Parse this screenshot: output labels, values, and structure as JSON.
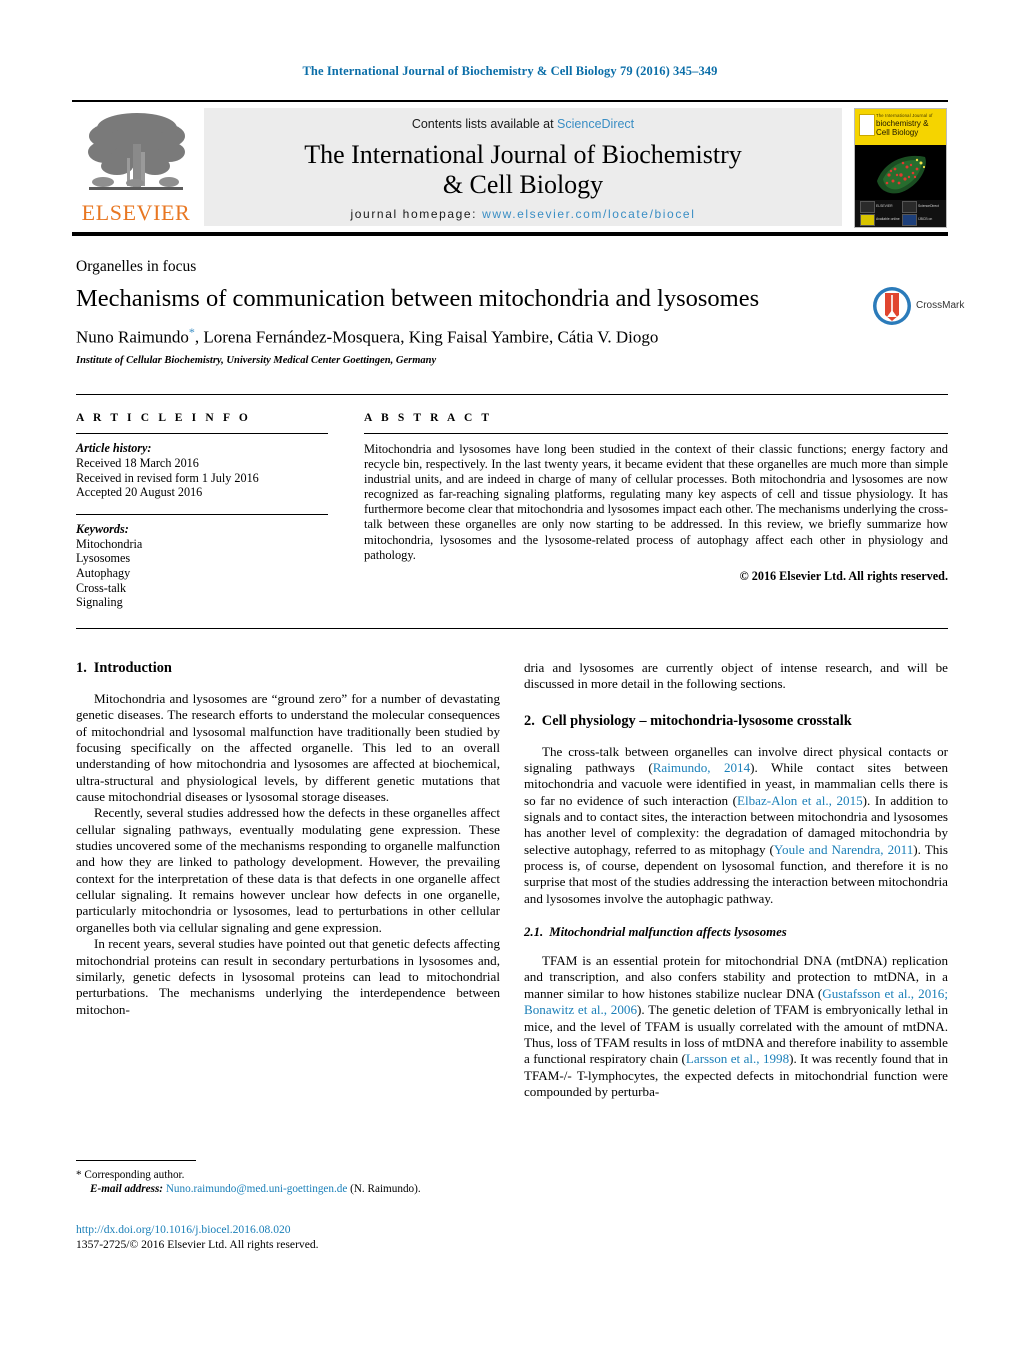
{
  "running_head": "The International Journal of Biochemistry & Cell Biology 79 (2016) 345–349",
  "masthead": {
    "publisher_name": "ELSEVIER",
    "contents_prefix": "Contents lists available at",
    "sciencedirect": "ScienceDirect",
    "journal_title_line1": "The International Journal of Biochemistry",
    "journal_title_line2": "& Cell Biology",
    "homepage_prefix": "journal homepage:",
    "homepage_url": "www.elsevier.com/locate/biocel",
    "cover": {
      "top_small": "The International Journal of",
      "title_line1": "biochemistry &",
      "title_line2": "Cell Biology",
      "icon_labels": [
        "ELSEVIER",
        "ScienceDirect",
        "Available online",
        "IJBCB on"
      ]
    },
    "accent_blue": "#3a8ec4",
    "elsevier_orange": "#E87722",
    "band_yellow": "#f5d400"
  },
  "article": {
    "section_type": "Organelles in focus",
    "title": "Mechanisms of communication between mitochondria and lysosomes",
    "authors": "Nuno Raimundo",
    "authors_rest": ", Lorena Fernández-Mosquera, King Faisal Yambire, Cátia V. Diogo",
    "corresponding_marker": "*",
    "affiliation": "Institute of Cellular Biochemistry, University Medical Center Goettingen, Germany",
    "crossmark_label": "CrossMark"
  },
  "article_info": {
    "heading": "A R T I C L E   I N F O",
    "history_label": "Article history:",
    "history": [
      "Received 18 March 2016",
      "Received in revised form 1 July 2016",
      "Accepted 20 August 2016"
    ],
    "keywords_label": "Keywords:",
    "keywords": [
      "Mitochondria",
      "Lysosomes",
      "Autophagy",
      "Cross-talk",
      "Signaling"
    ]
  },
  "abstract": {
    "heading": "A B S T R A C T",
    "text": "Mitochondria and lysosomes have long been studied in the context of their classic functions; energy factory and recycle bin, respectively. In the last twenty years, it became evident that these organelles are much more than simple industrial units, and are indeed in charge of many of cellular processes. Both mitochondria and lysosomes are now recognized as far-reaching signaling platforms, regulating many key aspects of cell and tissue physiology. It has furthermore become clear that mitochondria and lysosomes impact each other. The mechanisms underlying the cross-talk between these organelles are only now starting to be addressed. In this review, we briefly summarize how mitochondria, lysosomes and the lysosome-related process of autophagy affect each other in physiology and pathology.",
    "copyright": "© 2016 Elsevier Ltd. All rights reserved."
  },
  "body": {
    "intro_heading_num": "1.",
    "intro_heading_text": "Introduction",
    "p1": "Mitochondria and lysosomes are “ground zero” for a number of devastating genetic diseases. The research efforts to understand the molecular consequences of mitochondrial and lysosomal malfunction have traditionally been studied by focusing specifically on the affected organelle. This led to an overall understanding of how mitochondria and lysosomes are affected at biochemical, ultra-structural and physiological levels, by different genetic mutations that cause mitochondrial diseases or lysosomal storage diseases.",
    "p2": "Recently, several studies addressed how the defects in these organelles affect cellular signaling pathways, eventually modulating gene expression. These studies uncovered some of the mechanisms responding to organelle malfunction and how they are linked to pathology development. However, the prevailing context for the interpretation of these data is that defects in one organelle affect cellular signaling. It remains however unclear how defects in one organelle, particularly mitochondria or lysosomes, lead to perturbations in other cellular organelles both via cellular signaling and gene expression.",
    "p3": "In recent years, several studies have pointed out that genetic defects affecting mitochondrial proteins can result in secondary perturbations in lysosomes and, similarly, genetic defects in lysosomal proteins can lead to mitochondrial perturbations. The mechanisms underlying the interdependence between mitochon-",
    "p3_cont": "dria and lysosomes are currently object of intense research, and will be discussed in more detail in the following sections.",
    "sec2_heading_num": "2.",
    "sec2_heading_text": "Cell physiology – mitochondria-lysosome crosstalk",
    "p4_a": "The cross-talk between organelles can involve direct physical contacts or signaling pathways (",
    "p4_cite1": "Raimundo, 2014",
    "p4_b": "). While contact sites between mitochondria and vacuole were identified in yeast, in mammalian cells there is so far no evidence of such interaction (",
    "p4_cite2": "Elbaz-Alon et al., 2015",
    "p4_c": "). In addition to signals and to contact sites, the interaction between mitochondria and lysosomes has another level of complexity: the degradation of damaged mitochondria by selective autophagy, referred to as mitophagy (",
    "p4_cite3": "Youle and Narendra, 2011",
    "p4_d": "). This process is, of course, dependent on lysosomal function, and therefore it is no surprise that most of the studies addressing the interaction between mitochondria and lysosomes involve the autophagic pathway.",
    "sec21_heading_num": "2.1.",
    "sec21_heading_text": "Mitochondrial malfunction affects lysosomes",
    "p5_a": "TFAM is an essential protein for mitochondrial DNA (mtDNA) replication and transcription, and also confers stability and protection to mtDNA, in a manner similar to how histones stabilize nuclear DNA (",
    "p5_cite1": "Gustafsson et al., 2016; Bonawitz et al., 2006",
    "p5_b": "). The genetic deletion of TFAM is embryonically lethal in mice, and the level of TFAM is usually correlated with the amount of mtDNA. Thus, loss of TFAM results in loss of mtDNA and therefore inability to assemble a functional respiratory chain (",
    "p5_cite2": "Larsson et al., 1998",
    "p5_c": "). It was recently found that in TFAM-/- T-lymphocytes, the expected defects in mitochondrial function were compounded by perturba-"
  },
  "footer": {
    "corresponding_marker": "*",
    "corresponding_text": "Corresponding author.",
    "email_label": "E-mail address:",
    "email": "Nuno.raimundo@med.uni-goettingen.de",
    "email_attrib": "(N. Raimundo).",
    "doi_url": "http://dx.doi.org/10.1016/j.biocel.2016.08.020",
    "issn_line": "1357-2725/© 2016 Elsevier Ltd. All rights reserved."
  }
}
